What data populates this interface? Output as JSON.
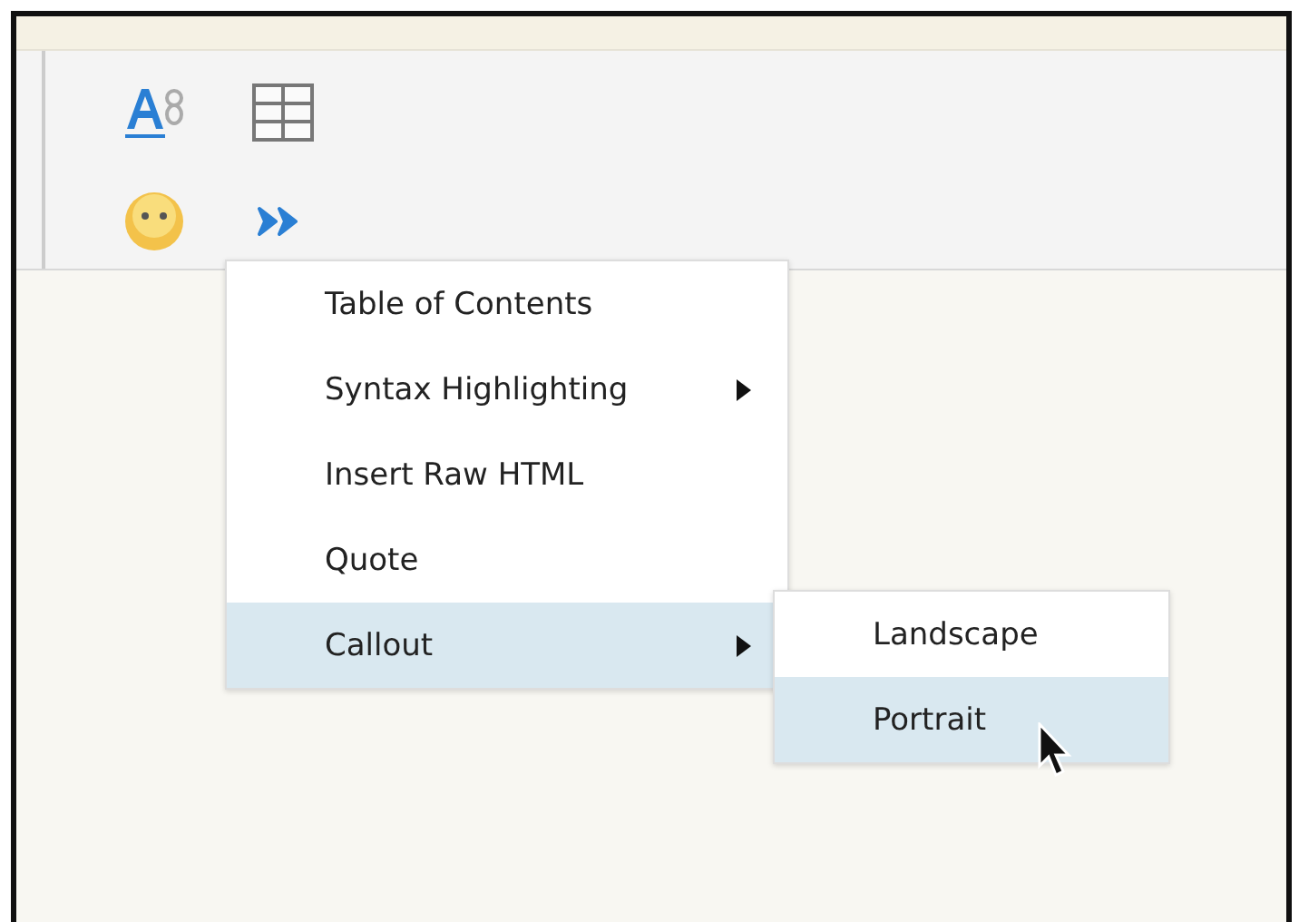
{
  "menu": {
    "items": [
      {
        "label": "Table of Contents",
        "selected": false,
        "has_submenu": false
      },
      {
        "label": "Syntax Highlighting",
        "selected": false,
        "has_submenu": true
      },
      {
        "label": "Insert Raw HTML",
        "selected": false,
        "has_submenu": false
      },
      {
        "label": "Quote",
        "selected": false,
        "has_submenu": false
      },
      {
        "label": "Callout",
        "selected": true,
        "has_submenu": true
      }
    ]
  },
  "submenu": {
    "items": [
      {
        "label": "Landscape",
        "selected": false
      },
      {
        "label": "Portrait",
        "selected": true
      }
    ]
  }
}
